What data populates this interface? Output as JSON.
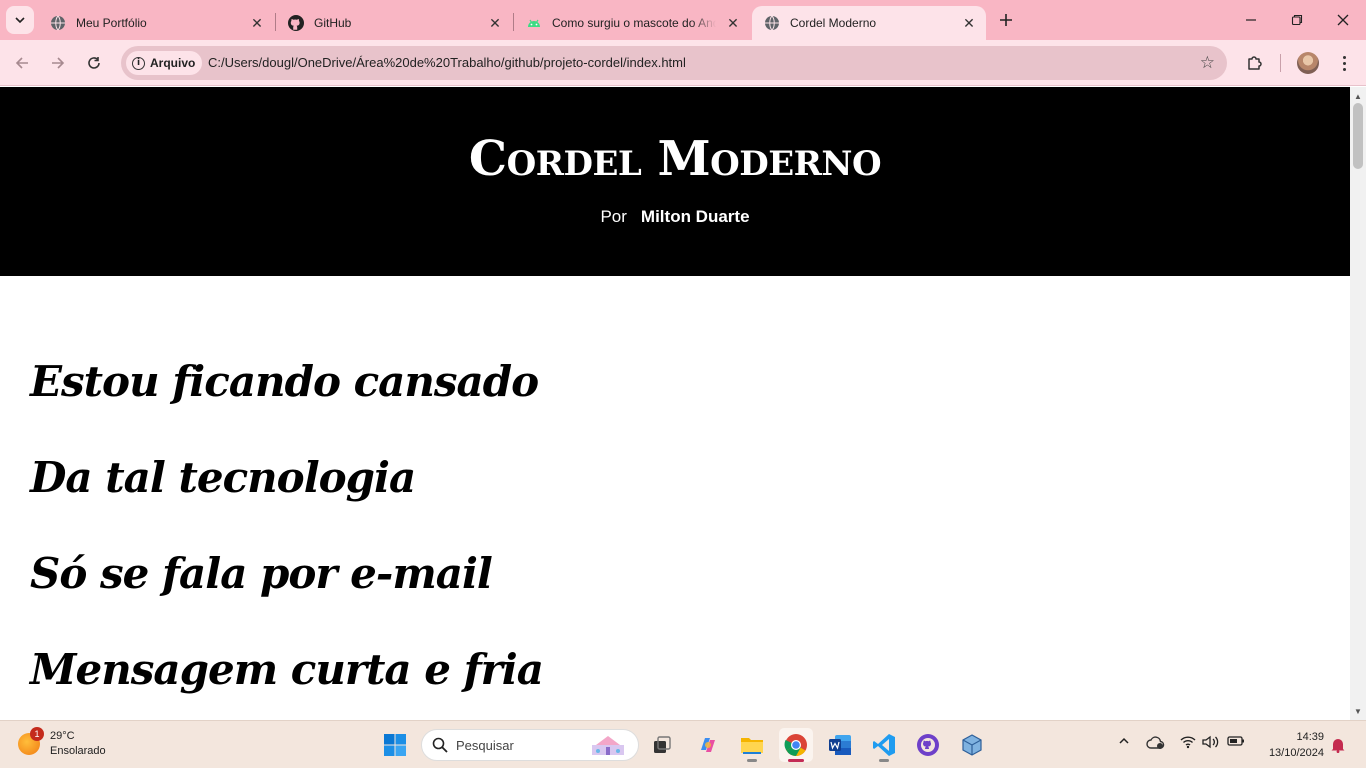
{
  "browser": {
    "tabs": [
      {
        "title": "Meu Portfólio",
        "favicon": "globe-icon",
        "active": false
      },
      {
        "title": "GitHub",
        "favicon": "github-icon",
        "active": false
      },
      {
        "title": "Como surgiu o mascote do Android",
        "favicon": "android-icon",
        "active": false
      },
      {
        "title": "Cordel Moderno",
        "favicon": "globe-icon",
        "active": true
      }
    ],
    "address_chip": "Arquivo",
    "url": "C:/Users/dougl/OneDrive/Área%20de%20Trabalho/github/projeto-cordel/index.html",
    "theme_color": "#f9b6c4"
  },
  "page": {
    "title": "Cordel Moderno",
    "by_label": "Por",
    "author": "Milton Duarte",
    "verses": [
      "Estou ficando cansado",
      "Da tal tecnologia",
      "Só se fala por e-mail",
      "Mensagem curta e fria"
    ]
  },
  "taskbar": {
    "weather_temp": "29°C",
    "weather_desc": "Ensolarado",
    "weather_badge": "1",
    "search_placeholder": "Pesquisar",
    "time": "14:39",
    "date": "13/10/2024"
  }
}
